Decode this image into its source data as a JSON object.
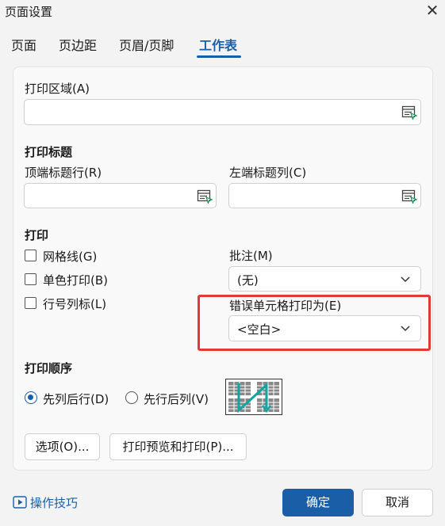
{
  "window": {
    "title": "页面设置"
  },
  "tabs": [
    {
      "label": "页面",
      "active": false
    },
    {
      "label": "页边距",
      "active": false
    },
    {
      "label": "页眉/页脚",
      "active": false
    },
    {
      "label": "工作表",
      "active": true
    }
  ],
  "print_area": {
    "label": "打印区域(A)",
    "value": ""
  },
  "print_titles": {
    "heading": "打印标题",
    "top_rows": {
      "label": "顶端标题行(R)",
      "value": ""
    },
    "left_cols": {
      "label": "左端标题列(C)",
      "value": ""
    }
  },
  "print": {
    "heading": "打印",
    "gridlines": {
      "label": "网格线(G)",
      "checked": false
    },
    "mono": {
      "label": "单色打印(B)",
      "checked": false
    },
    "row_col_headers": {
      "label": "行号列标(L)",
      "checked": false
    },
    "comments": {
      "label": "批注(M)",
      "value": "(无)"
    },
    "cell_errors": {
      "label": "错误单元格打印为(E)",
      "value": "<空白>"
    }
  },
  "print_order": {
    "heading": "打印顺序",
    "down_then_over": {
      "label": "先列后行(D)",
      "selected": true
    },
    "over_then_down": {
      "label": "先行后列(V)",
      "selected": false
    }
  },
  "buttons": {
    "options": "选项(O)...",
    "preview": "打印预览和打印(P)...",
    "ok": "确定",
    "cancel": "取消"
  },
  "tips_link": "操作技巧",
  "colors": {
    "accent": "#1b5ea8",
    "highlight": "#e53935"
  }
}
